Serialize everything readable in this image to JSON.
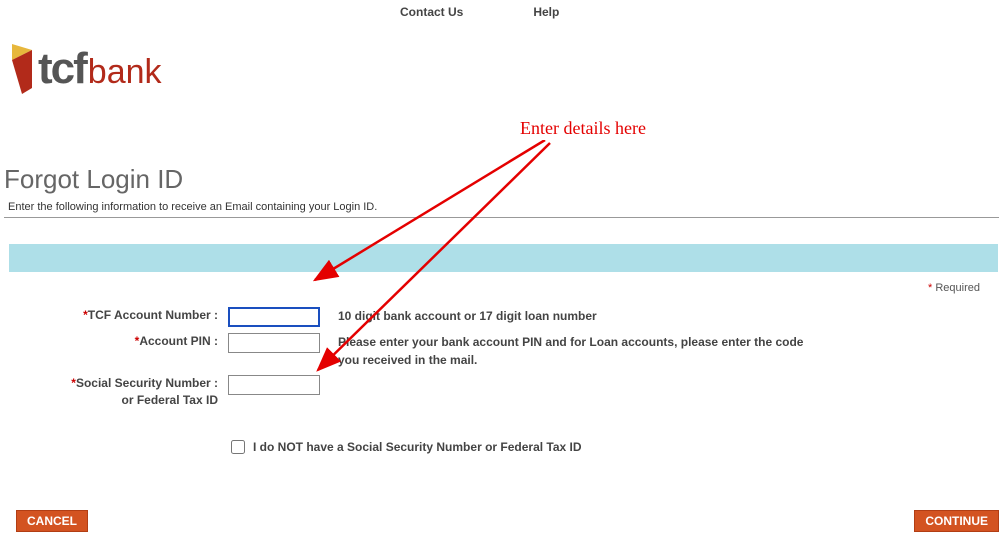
{
  "nav": {
    "contact": "Contact Us",
    "help": "Help"
  },
  "logo": {
    "tcf": "tcf",
    "bank": "bank"
  },
  "annotation": {
    "text": "Enter details here"
  },
  "page": {
    "heading": "Forgot Login ID",
    "sub": "Enter the following information to receive an Email containing your Login ID."
  },
  "required_note": "Required",
  "fields": {
    "account_number": {
      "label": "TCF Account Number :",
      "help": "10 digit bank account or 17 digit loan number",
      "value": ""
    },
    "account_pin": {
      "label": "Account PIN :",
      "help": "Please enter your bank account PIN and for Loan accounts, please enter the code you received in the mail.",
      "value": ""
    },
    "ssn": {
      "label_line1": "Social Security Number :",
      "label_line2": "or Federal Tax ID",
      "value": ""
    }
  },
  "checkbox": {
    "label": "I do NOT have a Social Security Number or Federal Tax ID"
  },
  "buttons": {
    "cancel": "CANCEL",
    "continue": "CONTINUE"
  }
}
